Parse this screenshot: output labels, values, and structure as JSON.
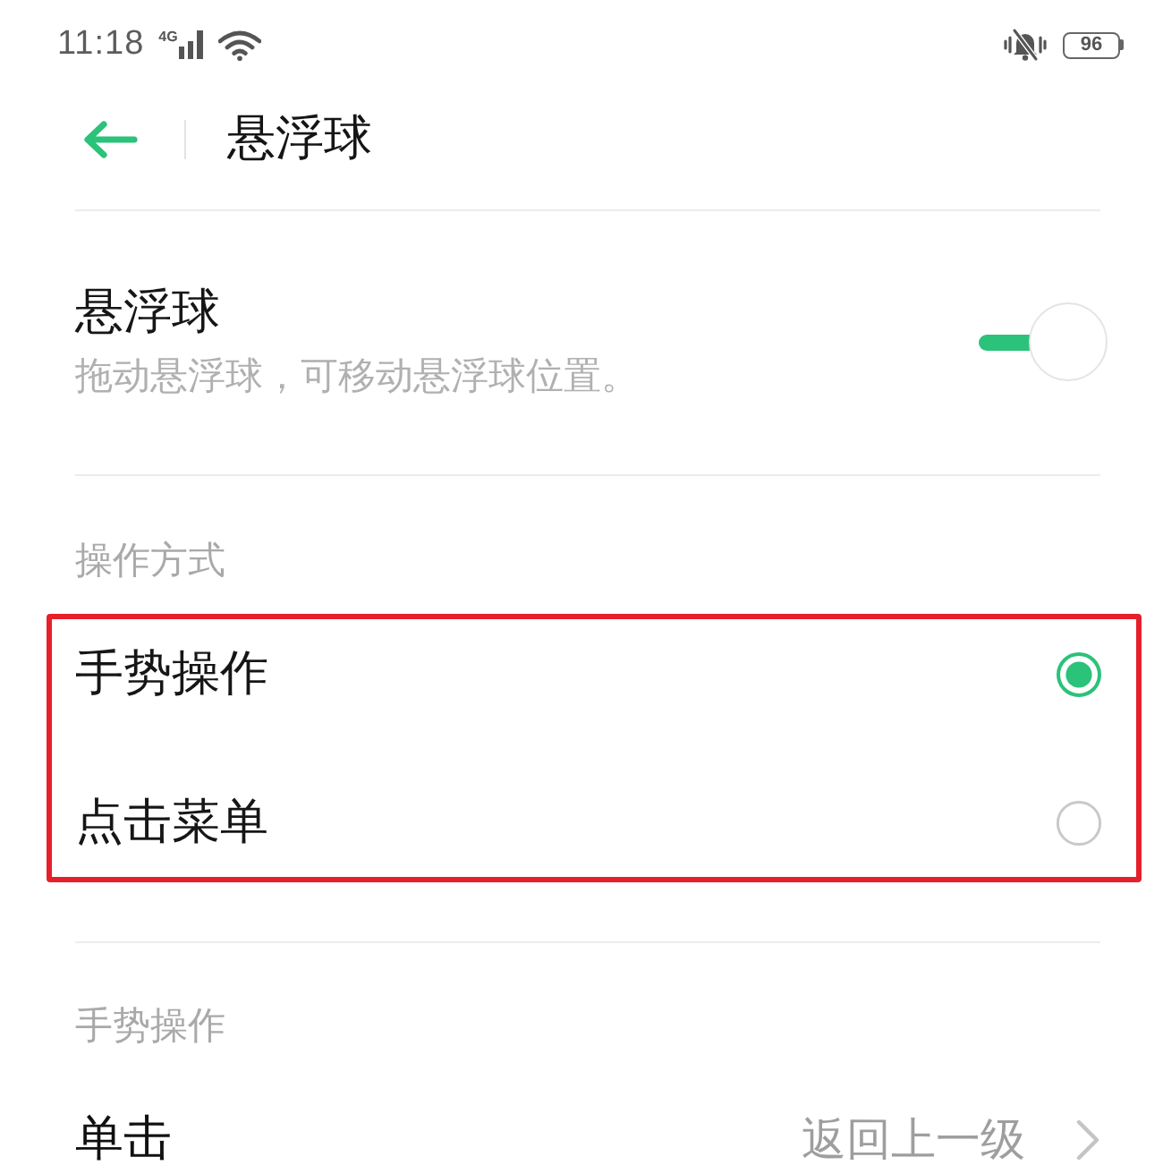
{
  "status_bar": {
    "time": "11:18",
    "network": "4G",
    "battery": "96"
  },
  "header": {
    "title": "悬浮球"
  },
  "floating_ball": {
    "title": "悬浮球",
    "description": "拖动悬浮球，可移动悬浮球位置。",
    "on": true
  },
  "operation_mode": {
    "heading": "操作方式",
    "options": [
      {
        "label": "手势操作",
        "selected": true
      },
      {
        "label": "点击菜单",
        "selected": false
      }
    ]
  },
  "gestures": {
    "heading": "手势操作",
    "items": [
      {
        "label": "单击",
        "value": "返回上一级"
      }
    ]
  }
}
